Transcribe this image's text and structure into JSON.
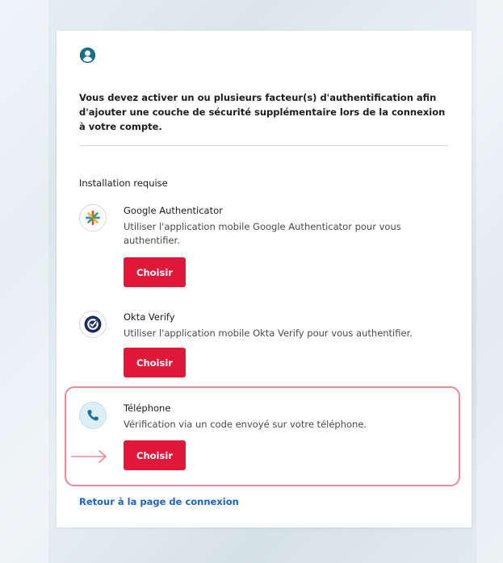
{
  "intro_text": "Vous devez activer un ou plusieurs facteur(s) d'authentification afin d'ajouter une couche de sécurité supplémentaire lors de la connexion à votre compte.",
  "section_title": "Installation requise",
  "factors": [
    {
      "name": "Google Authenticator",
      "description": "Utiliser l'application mobile Google Authenticator pour vous authentifier.",
      "button_label": "Choisir",
      "icon": "google-authenticator-icon"
    },
    {
      "name": "Okta Verify",
      "description": "Utiliser l'application mobile Okta Verify pour vous authentifier.",
      "button_label": "Choisir",
      "icon": "okta-verify-icon"
    },
    {
      "name": "Téléphone",
      "description": "Vérification via un code envoyé sur votre téléphone.",
      "button_label": "Choisir",
      "icon": "phone-icon"
    }
  ],
  "back_link": "Retour à la page de connexion",
  "colors": {
    "primary_button": "#e0193a",
    "link": "#1d63c8",
    "highlight": "#e88a9a",
    "icon_teal": "#1a6e86"
  },
  "icons": {
    "header": "user-circle-icon",
    "annotation": "arrow-right-icon"
  }
}
